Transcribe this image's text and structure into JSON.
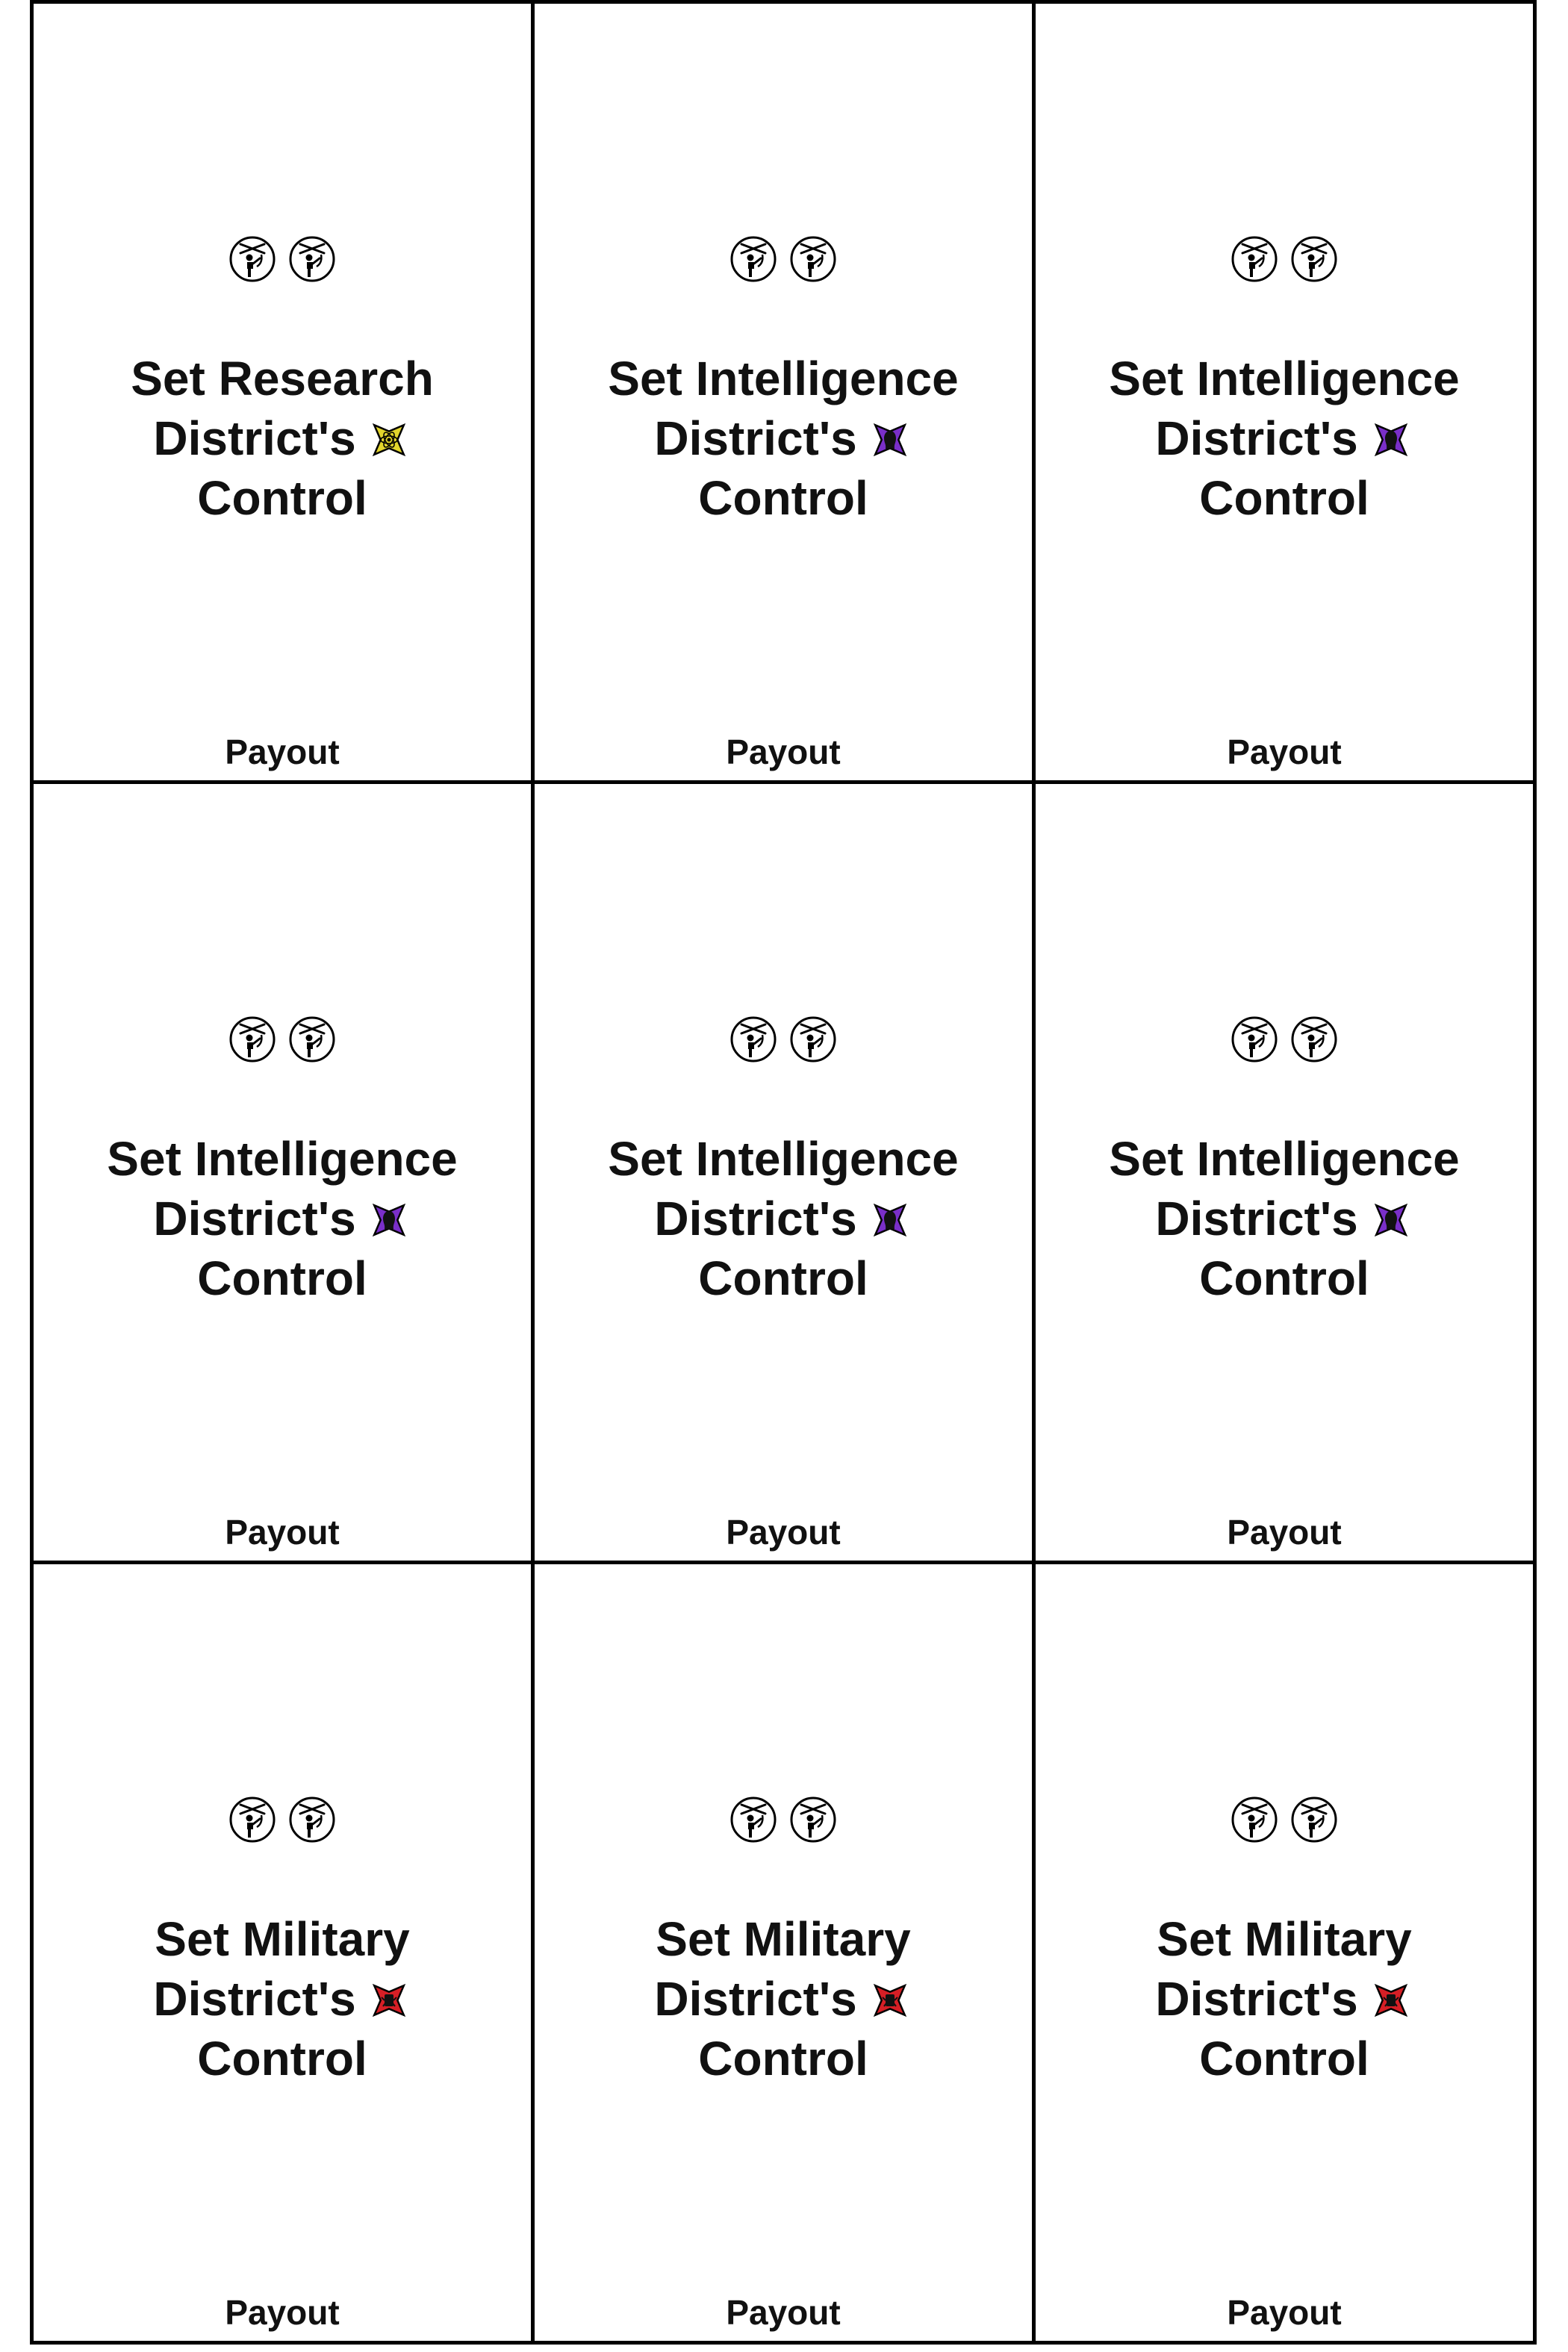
{
  "cards": [
    {
      "set_label": "Set Research",
      "district_label": "District's",
      "control_label": "Control",
      "district": "research",
      "district_icon": "research-star-icon",
      "district_color": "#e2d52c",
      "payout_label": "Payout",
      "cost_icons": [
        "worker-figure-icon",
        "worker-figure-icon"
      ]
    },
    {
      "set_label": "Set Intelligence",
      "district_label": "District's",
      "control_label": "Control",
      "district": "intelligence",
      "district_icon": "intelligence-star-icon",
      "district_color": "#7a2fc9",
      "payout_label": "Payout",
      "cost_icons": [
        "worker-figure-icon",
        "worker-figure-icon"
      ]
    },
    {
      "set_label": "Set Intelligence",
      "district_label": "District's",
      "control_label": "Control",
      "district": "intelligence",
      "district_icon": "intelligence-star-icon",
      "district_color": "#7a2fc9",
      "payout_label": "Payout",
      "cost_icons": [
        "worker-figure-icon",
        "worker-figure-icon"
      ]
    },
    {
      "set_label": "Set Intelligence",
      "district_label": "District's",
      "control_label": "Control",
      "district": "intelligence",
      "district_icon": "intelligence-star-icon",
      "district_color": "#7a2fc9",
      "payout_label": "Payout",
      "cost_icons": [
        "worker-figure-icon",
        "worker-figure-icon"
      ]
    },
    {
      "set_label": "Set Intelligence",
      "district_label": "District's",
      "control_label": "Control",
      "district": "intelligence",
      "district_icon": "intelligence-star-icon",
      "district_color": "#7a2fc9",
      "payout_label": "Payout",
      "cost_icons": [
        "worker-figure-icon",
        "worker-figure-icon"
      ]
    },
    {
      "set_label": "Set Intelligence",
      "district_label": "District's",
      "control_label": "Control",
      "district": "intelligence",
      "district_icon": "intelligence-star-icon",
      "district_color": "#7a2fc9",
      "payout_label": "Payout",
      "cost_icons": [
        "worker-figure-icon",
        "worker-figure-icon"
      ]
    },
    {
      "set_label": "Set Military",
      "district_label": "District's",
      "control_label": "Control",
      "district": "military",
      "district_icon": "military-star-icon",
      "district_color": "#d61f26",
      "payout_label": "Payout",
      "cost_icons": [
        "worker-figure-icon",
        "worker-figure-icon"
      ]
    },
    {
      "set_label": "Set Military",
      "district_label": "District's",
      "control_label": "Control",
      "district": "military",
      "district_icon": "military-star-icon",
      "district_color": "#d61f26",
      "payout_label": "Payout",
      "cost_icons": [
        "worker-figure-icon",
        "worker-figure-icon"
      ]
    },
    {
      "set_label": "Set Military",
      "district_label": "District's",
      "control_label": "Control",
      "district": "military",
      "district_icon": "military-star-icon",
      "district_color": "#d61f26",
      "payout_label": "Payout",
      "cost_icons": [
        "worker-figure-icon",
        "worker-figure-icon"
      ]
    }
  ]
}
